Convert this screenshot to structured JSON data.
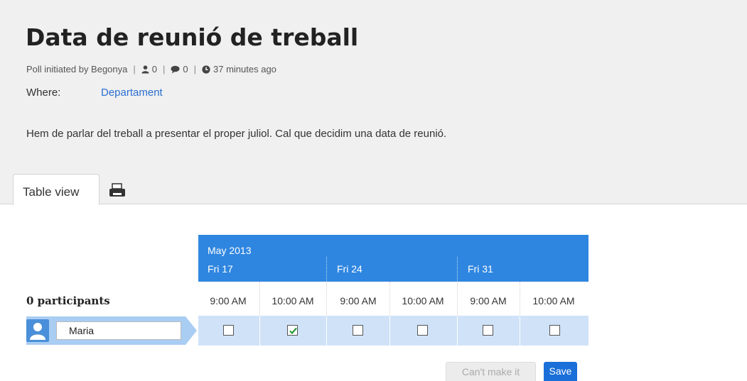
{
  "poll": {
    "title": "Data de reunió de treball",
    "initiated_by": "Poll initiated by Begonya",
    "participant_count": "0",
    "comment_count": "0",
    "time_ago": "37 minutes ago",
    "where_label": "Where:",
    "where_value": "Departament",
    "description": "Hem de parlar del treball a presentar el proper juliol. Cal que decidim una data de reunió."
  },
  "tabs": {
    "table_view": "Table view"
  },
  "icons": {
    "print": "printer-icon",
    "user": "user-icon",
    "comment": "comment-icon",
    "clock": "clock-icon",
    "avatar": "avatar-icon"
  },
  "colors": {
    "accent": "#2f86e0",
    "row_bg": "#cfe2f8",
    "link": "#2a6fd1",
    "save": "#1a6fd8"
  },
  "table": {
    "month": "May 2013",
    "days": [
      "Fri 17",
      "Fri 24",
      "Fri 31"
    ],
    "times": [
      "9:00 AM",
      "10:00 AM",
      "9:00 AM",
      "10:00 AM",
      "9:00 AM",
      "10:00 AM"
    ],
    "participants_label": "0 participants",
    "participant_name": "Maria",
    "checked": [
      false,
      true,
      false,
      false,
      false,
      false
    ]
  },
  "buttons": {
    "cant_make_it": "Can't make it",
    "save": "Save"
  }
}
